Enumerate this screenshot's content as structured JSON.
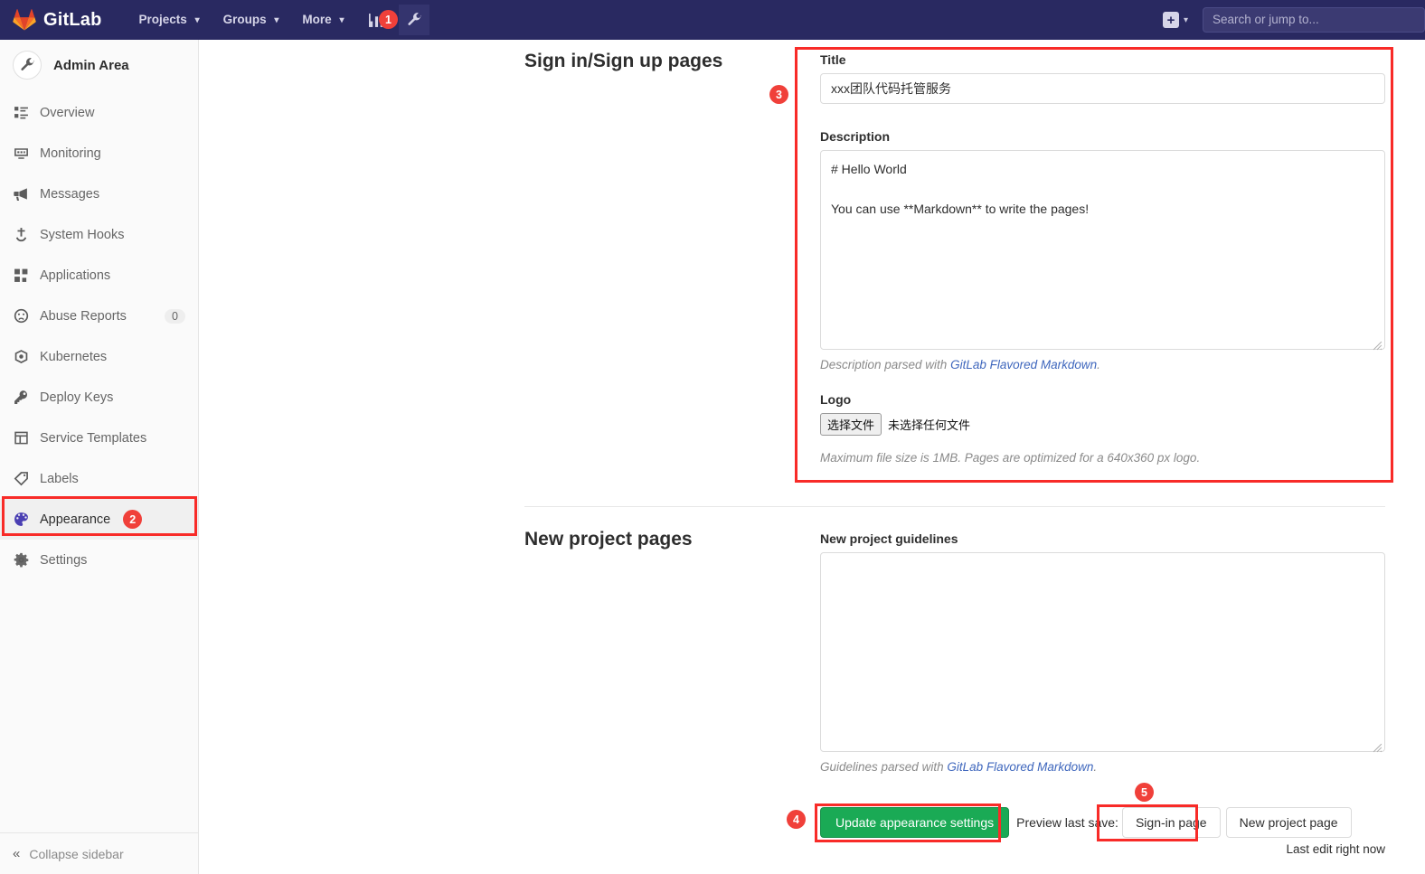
{
  "navbar": {
    "brand": "GitLab",
    "logo_icon": "gitlab-fox-logo",
    "links": [
      {
        "label": "Projects",
        "icon": "chevron-down-icon"
      },
      {
        "label": "Groups",
        "icon": "chevron-down-icon"
      },
      {
        "label": "More",
        "icon": "chevron-down-icon"
      }
    ],
    "analytics_icon": "chart-bar-icon",
    "admin_icon": "wrench-icon",
    "plus_icon": "plus-square-icon",
    "plus_caret_icon": "chevron-down-icon",
    "search_placeholder": "Search or jump to...",
    "search_value": ""
  },
  "sidebar": {
    "title": "Admin Area",
    "avatar_icon": "wrench-icon",
    "items": [
      {
        "label": "Overview",
        "icon": "overview-list-icon",
        "badge": ""
      },
      {
        "label": "Monitoring",
        "icon": "monitor-icon",
        "badge": ""
      },
      {
        "label": "Messages",
        "icon": "megaphone-icon",
        "badge": ""
      },
      {
        "label": "System Hooks",
        "icon": "hook-icon",
        "badge": ""
      },
      {
        "label": "Applications",
        "icon": "applications-grid-icon",
        "badge": ""
      },
      {
        "label": "Abuse Reports",
        "icon": "sad-face-icon",
        "badge": "0"
      },
      {
        "label": "Kubernetes",
        "icon": "kubernetes-icon",
        "badge": ""
      },
      {
        "label": "Deploy Keys",
        "icon": "key-icon",
        "badge": ""
      },
      {
        "label": "Service Templates",
        "icon": "template-icon",
        "badge": ""
      },
      {
        "label": "Labels",
        "icon": "label-tag-icon",
        "badge": ""
      },
      {
        "label": "Appearance",
        "icon": "palette-icon",
        "badge": "",
        "marker": "2",
        "selected": true
      },
      {
        "label": "Settings",
        "icon": "gear-icon",
        "badge": ""
      }
    ],
    "collapse_label": "Collapse sidebar",
    "collapse_icon": "double-chevron-left-icon"
  },
  "markers": {
    "navbar_admin": "1",
    "sidebar_appearance": "2",
    "signin_panel": "3",
    "update_button": "4",
    "signin_preview": "5"
  },
  "signin_section": {
    "heading": "Sign in/Sign up pages",
    "title_label": "Title",
    "title_value": "xxx团队代码托管服务",
    "description_label": "Description",
    "description_value": "# Hello World\n\nYou can use **Markdown** to write the pages!",
    "description_hint_prefix": "Description parsed with ",
    "description_hint_link": "GitLab Flavored Markdown",
    "description_hint_suffix": ".",
    "logo_label": "Logo",
    "logo_choose_button": "选择文件",
    "logo_file_status": "未选择任何文件",
    "logo_hint": "Maximum file size is 1MB. Pages are optimized for a 640x360 px logo."
  },
  "newproject_section": {
    "heading": "New project pages",
    "guidelines_label": "New project guidelines",
    "guidelines_value": "",
    "guidelines_hint_prefix": "Guidelines parsed with ",
    "guidelines_hint_link": "GitLab Flavored Markdown",
    "guidelines_hint_suffix": "."
  },
  "actions": {
    "update_button": "Update appearance settings",
    "preview_label": "Preview last save:",
    "signin_page_button": "Sign-in page",
    "new_project_page_button": "New project page",
    "last_edit": "Last edit right now"
  },
  "colors": {
    "navbar_bg": "#292961",
    "accent_green": "#1aaa55",
    "marker_red": "#f0403a",
    "highlight_red": "#f82b28",
    "link_blue": "#3f67bd"
  }
}
